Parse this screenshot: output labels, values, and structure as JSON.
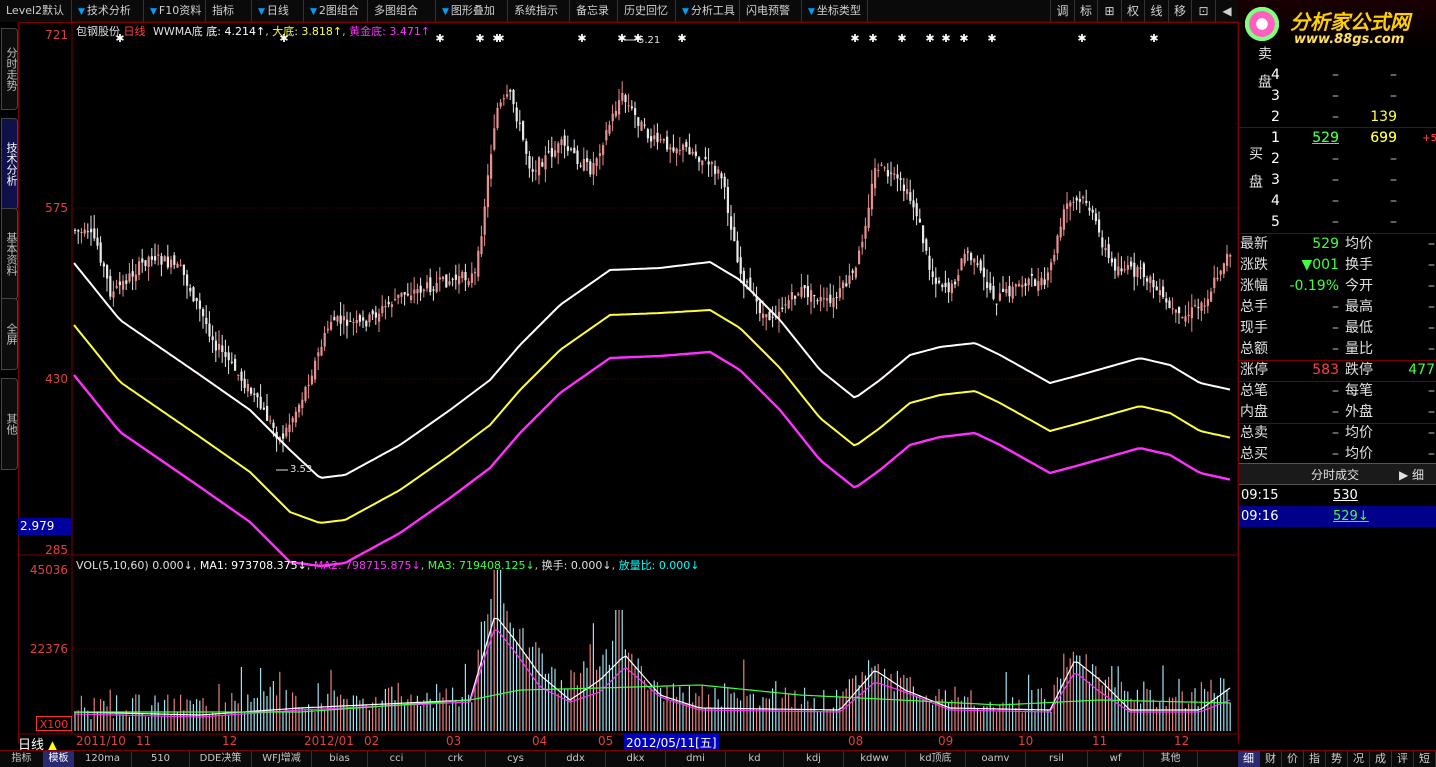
{
  "toolbar": {
    "items": [
      {
        "label": "Level2默认",
        "w": 72
      },
      {
        "label": "技术分析",
        "w": 72,
        "dd": true
      },
      {
        "label": "F10资料",
        "w": 62,
        "dd": true
      },
      {
        "label": "指标",
        "w": 46
      },
      {
        "label": "日线",
        "w": 52,
        "dd": true
      },
      {
        "label": "2图组合",
        "w": 64,
        "dd": true
      },
      {
        "label": "多图组合",
        "w": 68
      },
      {
        "label": "图形叠加",
        "w": 72,
        "dd": true
      },
      {
        "label": "系统指示",
        "w": 62
      },
      {
        "label": "备忘录",
        "w": 48
      },
      {
        "label": "历史回忆",
        "w": 58
      },
      {
        "label": "分析工具",
        "w": 64,
        "dd": true
      },
      {
        "label": "闪电预警",
        "w": 62
      },
      {
        "label": "坐标类型",
        "w": 66,
        "dd": true
      }
    ],
    "right_buttons": [
      "调",
      "标",
      "⊞",
      "权",
      "线",
      "移",
      "⊡",
      "◀"
    ]
  },
  "logo": {
    "name": "分析家公式网",
    "url": "www.88gs.com"
  },
  "left_tabs": [
    {
      "label": "分时走势",
      "active": false
    },
    {
      "label": "技术分析",
      "active": true
    },
    {
      "label": "基本资料",
      "active": false
    },
    {
      "label": "全屏",
      "active": false
    },
    {
      "label": "其他",
      "active": false
    }
  ],
  "main_legend": {
    "stock": "包钢股份",
    "period": "日线",
    "indicator": "WWMA底",
    "bottom_label": "底: 4.214↑",
    "big_bottom_label": "大底: 3.818↑",
    "gold_bottom_label": "黄金底: 3.471↑"
  },
  "price_axis": {
    "ticks": [
      "721",
      "575",
      "430",
      "285"
    ],
    "cursor_value": "2.979"
  },
  "annotations": {
    "high": "5.21",
    "low": "3.53"
  },
  "vol_legend": {
    "name": "VOL(5,10,60)",
    "vol": "0.000↓",
    "ma1": "MA1: 973708.375↓",
    "ma2": "MA2: 798715.875↓",
    "ma3": "MA3: 719408.125↓",
    "turnover": "换手: 0.000↓",
    "vol_ratio_label": "放量比:",
    "vol_ratio_value": "0.000↓"
  },
  "vol_axis": {
    "ticks": [
      "45036",
      "22376"
    ],
    "unit": "X100"
  },
  "x_axis": {
    "period_label": "日线",
    "labels": [
      "2011/10",
      "11",
      "12",
      "2012/01",
      "02",
      "03",
      "04",
      "05",
      "2012/05/11[五]",
      "08",
      "09",
      "10",
      "11",
      "12"
    ]
  },
  "bottom_tabs": [
    "指标",
    "模板",
    "120ma",
    "510",
    "DDE决策",
    "WFJ增减",
    "bias",
    "cci",
    "crk",
    "cys",
    "ddx",
    "dkx",
    "dmi",
    "kd",
    "kdj",
    "kdww",
    "kd顶底",
    "oamv",
    "rsil",
    "wf",
    "其他"
  ],
  "bottom_active": "模板",
  "right_bottom_tabs": [
    "细",
    "财",
    "价",
    "指",
    "势",
    "况",
    "成",
    "评",
    "短"
  ],
  "order_book": {
    "sell_label": "卖盘",
    "buy_label": "买盘",
    "sell": [
      {
        "lvl": "4",
        "price": "–",
        "vol": "–"
      },
      {
        "lvl": "3",
        "price": "–",
        "vol": "–"
      },
      {
        "lvl": "2",
        "price": "–",
        "vol": "139"
      },
      {
        "lvl": "1",
        "price": "529",
        "vol": "699",
        "extra": "+5"
      }
    ],
    "buy": [
      {
        "lvl": "1",
        "price": "529",
        "vol": "699",
        "extra": "+5"
      },
      {
        "lvl": "2",
        "price": "–",
        "vol": "–"
      },
      {
        "lvl": "3",
        "price": "–",
        "vol": "–"
      },
      {
        "lvl": "4",
        "price": "–",
        "vol": "–"
      },
      {
        "lvl": "5",
        "price": "–",
        "vol": "–"
      }
    ]
  },
  "quote": [
    {
      "l1": "最新",
      "v1": "529",
      "c1": "g",
      "l2": "均价",
      "v2": "–",
      "c2": "gr"
    },
    {
      "l1": "涨跌",
      "v1": "▼001",
      "c1": "g",
      "l2": "换手",
      "v2": "–",
      "c2": "gr"
    },
    {
      "l1": "涨幅",
      "v1": "-0.19%",
      "c1": "g",
      "l2": "今开",
      "v2": "–",
      "c2": "gr"
    },
    {
      "l1": "总手",
      "v1": "–",
      "c1": "gr",
      "l2": "最高",
      "v2": "–",
      "c2": "gr"
    },
    {
      "l1": "现手",
      "v1": "–",
      "c1": "gr",
      "l2": "最低",
      "v2": "–",
      "c2": "gr"
    },
    {
      "l1": "总额",
      "v1": "–",
      "c1": "gr",
      "l2": "量比",
      "v2": "–",
      "c2": "gr"
    },
    {
      "l1": "涨停",
      "v1": "583",
      "c1": "r",
      "l2": "跌停",
      "v2": "477",
      "c2": "g"
    },
    {
      "l1": "总笔",
      "v1": "–",
      "c1": "gr",
      "l2": "每笔",
      "v2": "–",
      "c2": "gr"
    },
    {
      "l1": "内盘",
      "v1": "–",
      "c1": "gr",
      "l2": "外盘",
      "v2": "–",
      "c2": "gr"
    },
    {
      "l1": "总卖",
      "v1": "–",
      "c1": "gr",
      "l2": "均价",
      "v2": "–",
      "c2": "gr"
    },
    {
      "l1": "总买",
      "v1": "–",
      "c1": "gr",
      "l2": "均价",
      "v2": "–",
      "c2": "gr"
    }
  ],
  "ticks_panel": {
    "title": "分时成交",
    "detail": "细",
    "rows": [
      {
        "time": "09:15",
        "price": "530"
      },
      {
        "time": "09:16",
        "price": "529↓"
      }
    ]
  },
  "colors": {
    "up": "#ff5050",
    "down": "#00ffff",
    "wwma": "#ffffff",
    "big": "#ffff40",
    "gold": "#ff30ff"
  }
}
